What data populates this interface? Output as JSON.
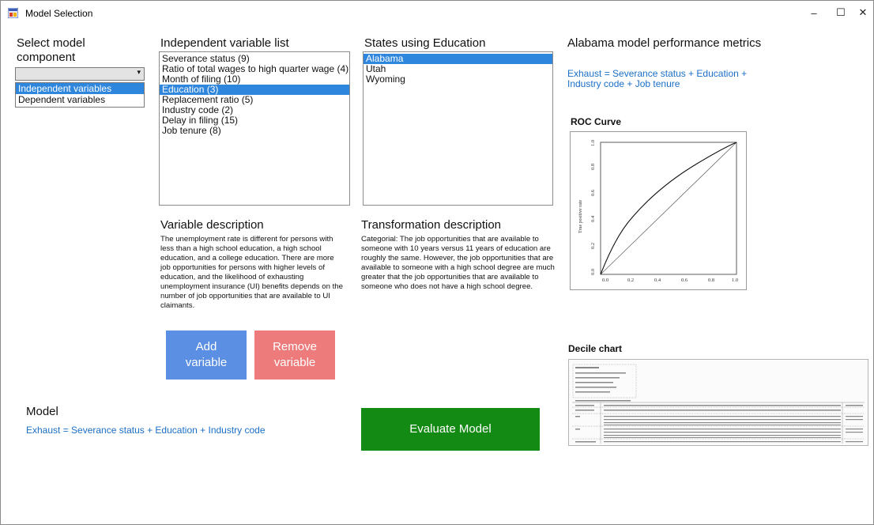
{
  "window": {
    "title": "Model Selection",
    "minimize": "–",
    "maximize": "☐",
    "close": "✕"
  },
  "select_component": {
    "heading": "Select model component",
    "combo_value": "",
    "options": [
      "Independent variables",
      "Dependent variables"
    ],
    "selected_index": 0
  },
  "independent_list": {
    "heading": "Independent variable list",
    "items": [
      "Severance status (9)",
      "Ratio of total wages to high quarter wage (4)",
      "Month of filing (10)",
      "Education (3)",
      "Replacement ratio (5)",
      "Industry code (2)",
      "Delay in filing (15)",
      "Job tenure (8)"
    ],
    "selected_index": 3
  },
  "states_list": {
    "heading": "States using Education",
    "items": [
      "Alabama",
      "Utah",
      "Wyoming"
    ],
    "selected_index": 0
  },
  "metrics": {
    "heading": "Alabama model performance metrics",
    "formula": "Exhaust = Severance status + Education + Industry code + Job tenure",
    "roc_heading": "ROC Curve",
    "decile_heading": "Decile chart"
  },
  "roc_chart": {
    "ylabel": "True positive rate",
    "x_ticks": [
      "0.0",
      "0.2",
      "0.4",
      "0.6",
      "0.8",
      "1.0"
    ],
    "y_ticks": [
      "0.0",
      "0.2",
      "0.4",
      "0.6",
      "0.8",
      "1.0"
    ]
  },
  "variable_description": {
    "heading": "Variable description",
    "text": "The unemployment rate is different for persons with less than a high school education, a high school education, and a college education.  There are more job opportunities for persons with higher levels of education, and the likelihood of exhausting unemployment insurance (UI) benefits depends on the number of job opportunities that are available to UI claimants."
  },
  "transformation_description": {
    "heading": "Transformation description",
    "text": "Categorial: The job opportunities that are available to someone with 10 years versus 11 years of education are roughly the same.  However, the job opportunities that are available to someone with a high school degree are much greater that the job opportunities that are available to someone who does not have a high school degree."
  },
  "buttons": {
    "add": "Add variable",
    "remove": "Remove variable",
    "evaluate": "Evaluate Model"
  },
  "model": {
    "heading": "Model",
    "formula": "Exhaust = Severance status + Education + Industry code"
  },
  "colors": {
    "selection": "#2f86dd",
    "add_button": "#5b8fe3",
    "remove_button": "#ee7b7b",
    "evaluate_button": "#138a13",
    "formula_text": "#1b6fc7"
  }
}
